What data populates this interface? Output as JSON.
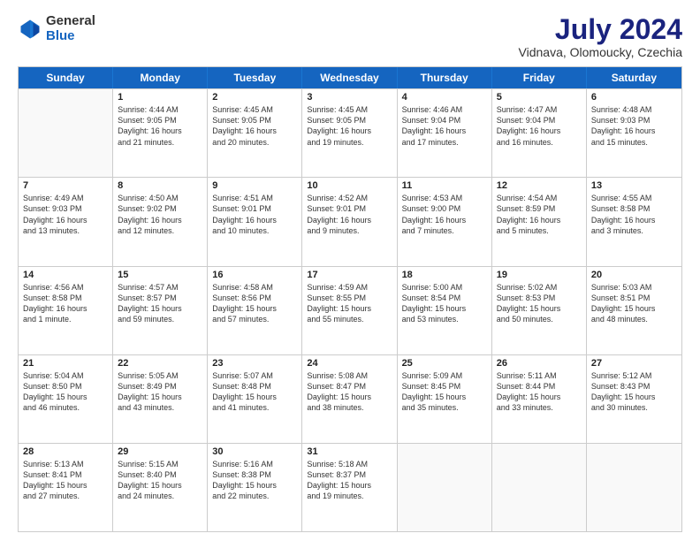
{
  "header": {
    "logo_general": "General",
    "logo_blue": "Blue",
    "month_title": "July 2024",
    "subtitle": "Vidnava, Olomoucky, Czechia"
  },
  "calendar": {
    "days_of_week": [
      "Sunday",
      "Monday",
      "Tuesday",
      "Wednesday",
      "Thursday",
      "Friday",
      "Saturday"
    ],
    "rows": [
      [
        {
          "day": "",
          "empty": true,
          "lines": []
        },
        {
          "day": "1",
          "empty": false,
          "lines": [
            "Sunrise: 4:44 AM",
            "Sunset: 9:05 PM",
            "Daylight: 16 hours",
            "and 21 minutes."
          ]
        },
        {
          "day": "2",
          "empty": false,
          "lines": [
            "Sunrise: 4:45 AM",
            "Sunset: 9:05 PM",
            "Daylight: 16 hours",
            "and 20 minutes."
          ]
        },
        {
          "day": "3",
          "empty": false,
          "lines": [
            "Sunrise: 4:45 AM",
            "Sunset: 9:05 PM",
            "Daylight: 16 hours",
            "and 19 minutes."
          ]
        },
        {
          "day": "4",
          "empty": false,
          "lines": [
            "Sunrise: 4:46 AM",
            "Sunset: 9:04 PM",
            "Daylight: 16 hours",
            "and 17 minutes."
          ]
        },
        {
          "day": "5",
          "empty": false,
          "lines": [
            "Sunrise: 4:47 AM",
            "Sunset: 9:04 PM",
            "Daylight: 16 hours",
            "and 16 minutes."
          ]
        },
        {
          "day": "6",
          "empty": false,
          "lines": [
            "Sunrise: 4:48 AM",
            "Sunset: 9:03 PM",
            "Daylight: 16 hours",
            "and 15 minutes."
          ]
        }
      ],
      [
        {
          "day": "7",
          "empty": false,
          "lines": [
            "Sunrise: 4:49 AM",
            "Sunset: 9:03 PM",
            "Daylight: 16 hours",
            "and 13 minutes."
          ]
        },
        {
          "day": "8",
          "empty": false,
          "lines": [
            "Sunrise: 4:50 AM",
            "Sunset: 9:02 PM",
            "Daylight: 16 hours",
            "and 12 minutes."
          ]
        },
        {
          "day": "9",
          "empty": false,
          "lines": [
            "Sunrise: 4:51 AM",
            "Sunset: 9:01 PM",
            "Daylight: 16 hours",
            "and 10 minutes."
          ]
        },
        {
          "day": "10",
          "empty": false,
          "lines": [
            "Sunrise: 4:52 AM",
            "Sunset: 9:01 PM",
            "Daylight: 16 hours",
            "and 9 minutes."
          ]
        },
        {
          "day": "11",
          "empty": false,
          "lines": [
            "Sunrise: 4:53 AM",
            "Sunset: 9:00 PM",
            "Daylight: 16 hours",
            "and 7 minutes."
          ]
        },
        {
          "day": "12",
          "empty": false,
          "lines": [
            "Sunrise: 4:54 AM",
            "Sunset: 8:59 PM",
            "Daylight: 16 hours",
            "and 5 minutes."
          ]
        },
        {
          "day": "13",
          "empty": false,
          "lines": [
            "Sunrise: 4:55 AM",
            "Sunset: 8:58 PM",
            "Daylight: 16 hours",
            "and 3 minutes."
          ]
        }
      ],
      [
        {
          "day": "14",
          "empty": false,
          "lines": [
            "Sunrise: 4:56 AM",
            "Sunset: 8:58 PM",
            "Daylight: 16 hours",
            "and 1 minute."
          ]
        },
        {
          "day": "15",
          "empty": false,
          "lines": [
            "Sunrise: 4:57 AM",
            "Sunset: 8:57 PM",
            "Daylight: 15 hours",
            "and 59 minutes."
          ]
        },
        {
          "day": "16",
          "empty": false,
          "lines": [
            "Sunrise: 4:58 AM",
            "Sunset: 8:56 PM",
            "Daylight: 15 hours",
            "and 57 minutes."
          ]
        },
        {
          "day": "17",
          "empty": false,
          "lines": [
            "Sunrise: 4:59 AM",
            "Sunset: 8:55 PM",
            "Daylight: 15 hours",
            "and 55 minutes."
          ]
        },
        {
          "day": "18",
          "empty": false,
          "lines": [
            "Sunrise: 5:00 AM",
            "Sunset: 8:54 PM",
            "Daylight: 15 hours",
            "and 53 minutes."
          ]
        },
        {
          "day": "19",
          "empty": false,
          "lines": [
            "Sunrise: 5:02 AM",
            "Sunset: 8:53 PM",
            "Daylight: 15 hours",
            "and 50 minutes."
          ]
        },
        {
          "day": "20",
          "empty": false,
          "lines": [
            "Sunrise: 5:03 AM",
            "Sunset: 8:51 PM",
            "Daylight: 15 hours",
            "and 48 minutes."
          ]
        }
      ],
      [
        {
          "day": "21",
          "empty": false,
          "lines": [
            "Sunrise: 5:04 AM",
            "Sunset: 8:50 PM",
            "Daylight: 15 hours",
            "and 46 minutes."
          ]
        },
        {
          "day": "22",
          "empty": false,
          "lines": [
            "Sunrise: 5:05 AM",
            "Sunset: 8:49 PM",
            "Daylight: 15 hours",
            "and 43 minutes."
          ]
        },
        {
          "day": "23",
          "empty": false,
          "lines": [
            "Sunrise: 5:07 AM",
            "Sunset: 8:48 PM",
            "Daylight: 15 hours",
            "and 41 minutes."
          ]
        },
        {
          "day": "24",
          "empty": false,
          "lines": [
            "Sunrise: 5:08 AM",
            "Sunset: 8:47 PM",
            "Daylight: 15 hours",
            "and 38 minutes."
          ]
        },
        {
          "day": "25",
          "empty": false,
          "lines": [
            "Sunrise: 5:09 AM",
            "Sunset: 8:45 PM",
            "Daylight: 15 hours",
            "and 35 minutes."
          ]
        },
        {
          "day": "26",
          "empty": false,
          "lines": [
            "Sunrise: 5:11 AM",
            "Sunset: 8:44 PM",
            "Daylight: 15 hours",
            "and 33 minutes."
          ]
        },
        {
          "day": "27",
          "empty": false,
          "lines": [
            "Sunrise: 5:12 AM",
            "Sunset: 8:43 PM",
            "Daylight: 15 hours",
            "and 30 minutes."
          ]
        }
      ],
      [
        {
          "day": "28",
          "empty": false,
          "lines": [
            "Sunrise: 5:13 AM",
            "Sunset: 8:41 PM",
            "Daylight: 15 hours",
            "and 27 minutes."
          ]
        },
        {
          "day": "29",
          "empty": false,
          "lines": [
            "Sunrise: 5:15 AM",
            "Sunset: 8:40 PM",
            "Daylight: 15 hours",
            "and 24 minutes."
          ]
        },
        {
          "day": "30",
          "empty": false,
          "lines": [
            "Sunrise: 5:16 AM",
            "Sunset: 8:38 PM",
            "Daylight: 15 hours",
            "and 22 minutes."
          ]
        },
        {
          "day": "31",
          "empty": false,
          "lines": [
            "Sunrise: 5:18 AM",
            "Sunset: 8:37 PM",
            "Daylight: 15 hours",
            "and 19 minutes."
          ]
        },
        {
          "day": "",
          "empty": true,
          "lines": []
        },
        {
          "day": "",
          "empty": true,
          "lines": []
        },
        {
          "day": "",
          "empty": true,
          "lines": []
        }
      ]
    ]
  }
}
